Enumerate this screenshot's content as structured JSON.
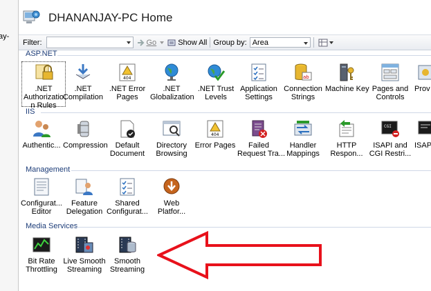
{
  "left_pane": {
    "fragment_1": "ay-",
    "fragment_2": ""
  },
  "header": {
    "title": "DHANANJAY-PC Home"
  },
  "toolbar": {
    "filter_label": "Filter:",
    "go_label": "Go",
    "show_all_label": "Show All",
    "group_by_label": "Group by:",
    "group_by_value": "Area"
  },
  "groups": [
    {
      "name": "ASP.NET",
      "tiles": [
        {
          "label1": ".NET",
          "label2": "Authorizatio",
          "label3": "n Rules",
          "icon": "lock-icon"
        },
        {
          "label1": ".NET",
          "label2": "Compilation",
          "label3": "",
          "icon": "download-arrows-icon"
        },
        {
          "label1": ".NET Error",
          "label2": "Pages",
          "label3": "",
          "icon": "warning-404-icon"
        },
        {
          "label1": ".NET",
          "label2": "Globalization",
          "label3": "",
          "icon": "globe-icon"
        },
        {
          "label1": ".NET Trust",
          "label2": "Levels",
          "label3": "",
          "icon": "globe-check-icon"
        },
        {
          "label1": "Application",
          "label2": "Settings",
          "label3": "",
          "icon": "checklist-icon"
        },
        {
          "label1": "Connection",
          "label2": "Strings",
          "label3": "",
          "icon": "database-text-icon"
        },
        {
          "label1": "Machine Key",
          "label2": "",
          "label3": "",
          "icon": "server-key-icon"
        },
        {
          "label1": "Pages and",
          "label2": "Controls",
          "label3": "",
          "icon": "page-controls-icon"
        },
        {
          "label1": "Prov",
          "label2": "",
          "label3": "",
          "icon": "providers-icon"
        }
      ]
    },
    {
      "name": "IIS",
      "tiles": [
        {
          "label1": "Authentic...",
          "label2": "",
          "label3": "",
          "icon": "users-icon"
        },
        {
          "label1": "Compression",
          "label2": "",
          "label3": "",
          "icon": "compression-icon"
        },
        {
          "label1": "Default",
          "label2": "Document",
          "label3": "",
          "icon": "document-check-icon"
        },
        {
          "label1": "Directory",
          "label2": "Browsing",
          "label3": "",
          "icon": "directory-browse-icon"
        },
        {
          "label1": "Error Pages",
          "label2": "",
          "label3": "",
          "icon": "error-page-icon"
        },
        {
          "label1": "Failed",
          "label2": "Request Tra...",
          "label3": "",
          "icon": "failed-request-icon"
        },
        {
          "label1": "Handler",
          "label2": "Mappings",
          "label3": "",
          "icon": "handler-mappings-icon"
        },
        {
          "label1": "HTTP",
          "label2": "Respon...",
          "label3": "",
          "icon": "http-response-icon"
        },
        {
          "label1": "ISAPI and",
          "label2": "CGI Restri...",
          "label3": "",
          "icon": "cgi-console-icon"
        },
        {
          "label1": "ISAPI",
          "label2": "",
          "label3": "",
          "icon": "isapi-icon"
        }
      ]
    },
    {
      "name": "Management",
      "tiles": [
        {
          "label1": "Configurat...",
          "label2": "Editor",
          "label3": "",
          "icon": "config-editor-icon"
        },
        {
          "label1": "Feature",
          "label2": "Delegation",
          "label3": "",
          "icon": "feature-delegation-icon"
        },
        {
          "label1": "Shared",
          "label2": "Configurat...",
          "label3": "",
          "icon": "shared-config-icon"
        },
        {
          "label1": "Web",
          "label2": "Platfor...",
          "label3": "",
          "icon": "web-platform-icon"
        }
      ]
    },
    {
      "name": "Media Services",
      "tiles": [
        {
          "label1": "Bit Rate",
          "label2": "Throttling",
          "label3": "",
          "icon": "bitrate-chart-icon"
        },
        {
          "label1": "Live Smooth",
          "label2": "Streaming",
          "label3": "",
          "icon": "live-streaming-icon"
        },
        {
          "label1": "Smooth",
          "label2": "Streaming",
          "label3": "",
          "icon": "smooth-streaming-icon"
        }
      ]
    }
  ],
  "colors": {
    "group_header": "#1c3c78",
    "arrow": "#e8111b"
  }
}
